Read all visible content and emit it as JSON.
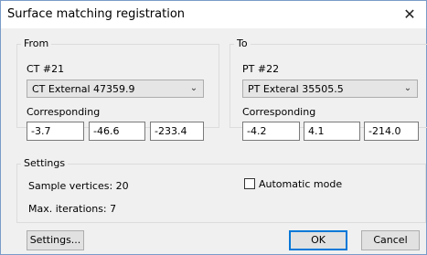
{
  "window": {
    "title": "Surface matching registration",
    "close_glyph": "✕"
  },
  "from": {
    "group_label": "From",
    "dataset": "CT #21",
    "select_value": "CT External  47359.9",
    "corresponding_label": "Corresponding",
    "coords": [
      "-3.7",
      "-46.6",
      "-233.4"
    ]
  },
  "to": {
    "group_label": "To",
    "dataset": "PT #22",
    "select_value": "PT Exteral  35505.5",
    "corresponding_label": "Corresponding",
    "coords": [
      "-4.2",
      "4.1",
      "-214.0"
    ]
  },
  "settings": {
    "group_label": "Settings",
    "sample_vertices": "Sample vertices: 20",
    "max_iterations": "Max. iterations:  7",
    "automatic_mode_label": "Automatic mode",
    "automatic_mode_checked": false
  },
  "buttons": {
    "settings": "Settings...",
    "ok": "OK",
    "cancel": "Cancel"
  },
  "colors": {
    "accent": "#0078d7",
    "title_border": "#7a9cc8",
    "background": "#f0f0f0"
  }
}
